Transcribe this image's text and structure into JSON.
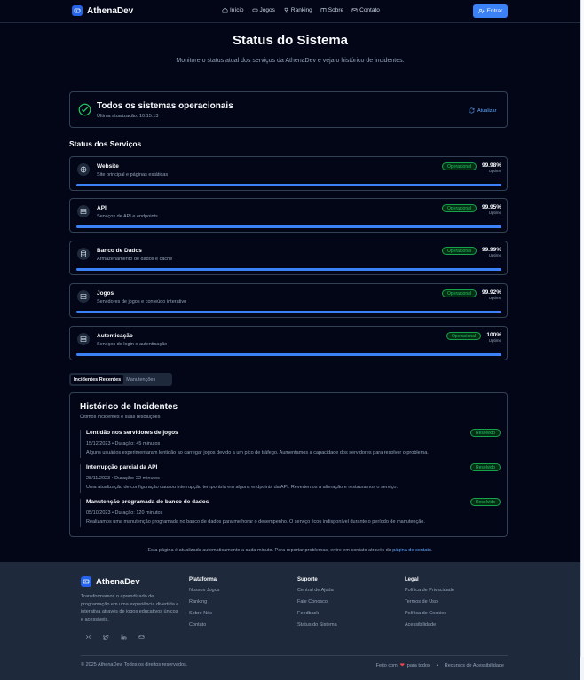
{
  "nav": {
    "brand": "AthenaDev",
    "links": [
      {
        "label": "Início",
        "icon": "home-icon"
      },
      {
        "label": "Jogos",
        "icon": "gamepad-icon"
      },
      {
        "label": "Ranking",
        "icon": "trophy-icon"
      },
      {
        "label": "Sobre",
        "icon": "book-icon"
      },
      {
        "label": "Contato",
        "icon": "mail-icon"
      }
    ],
    "login_label": "Entrar"
  },
  "hero": {
    "title": "Status do Sistema",
    "subtitle": "Monitore o status atual dos serviços da AthenaDev e veja o histórico de incidentes."
  },
  "overall": {
    "title": "Todos os sistemas operacionais",
    "updated": "Última atualização: 10:15:13",
    "refresh_label": "Atualizar"
  },
  "services_title": "Status dos Serviços",
  "services": [
    {
      "name": "Website",
      "desc": "Site principal e páginas estáticas",
      "status": "Operacional",
      "uptime": "99.98%",
      "uptime_fraction": 0.9998,
      "icon": "globe-icon"
    },
    {
      "name": "API",
      "desc": "Serviços de API e endpoints",
      "status": "Operacional",
      "uptime": "99.95%",
      "uptime_fraction": 0.9995,
      "icon": "server-icon"
    },
    {
      "name": "Banco de Dados",
      "desc": "Armazenamento de dados e cache",
      "status": "Operacional",
      "uptime": "99.99%",
      "uptime_fraction": 0.9999,
      "icon": "database-icon"
    },
    {
      "name": "Jogos",
      "desc": "Servidores de jogos e conteúdo interativo",
      "status": "Operacional",
      "uptime": "99.92%",
      "uptime_fraction": 0.9992,
      "icon": "server-icon"
    },
    {
      "name": "Autenticação",
      "desc": "Serviços de login e autenticação",
      "status": "Operacional",
      "uptime": "100%",
      "uptime_fraction": 1.0,
      "icon": "server-icon"
    }
  ],
  "uptime_label": "Uptime",
  "tabs": [
    "Incidentes Recentes",
    "Manutenções"
  ],
  "incidents": {
    "title": "Histórico de Incidentes",
    "subtitle": "Últimos incidentes e suas resoluções",
    "items": [
      {
        "name": "Lentidão nos servidores de jogos",
        "meta": "15/12/2023 • Duração: 45 minutos",
        "desc": "Alguns usuários experimentaram lentidão ao carregar jogos devido a um pico de tráfego. Aumentamos a capacidade dos servidores para resolver o problema.",
        "status": "Resolvido"
      },
      {
        "name": "Interrupção parcial da API",
        "meta": "28/11/2023 • Duração: 22 minutos",
        "desc": "Uma atualização de configuração causou interrupção temporária em alguns endpoints da API. Revertemos a alteração e restauramos o serviço.",
        "status": "Resolvido"
      },
      {
        "name": "Manutenção programada do banco de dados",
        "meta": "05/10/2023 • Duração: 120 minutos",
        "desc": "Realizamos uma manutenção programada no banco de dados para melhorar o desempenho. O serviço ficou indisponível durante o período de manutenção.",
        "status": "Resolvido"
      }
    ]
  },
  "note": {
    "text": "Esta página é atualizada automaticamente a cada minuto. Para reportar problemas, entre em contato através da",
    "link": "página de contato",
    "end": "."
  },
  "footer": {
    "brand": "AthenaDev",
    "about": "Transformamos o aprendizado de programação em uma experiência divertida e interativa através de jogos educativos únicos e acessíveis.",
    "social": [
      "twitter-icon",
      "twitter-bird-icon",
      "linkedin-icon",
      "mail-icon"
    ],
    "columns": [
      {
        "title": "Plataforma",
        "links": [
          "Nossos Jogos",
          "Ranking",
          "Sobre Nós",
          "Contato"
        ]
      },
      {
        "title": "Suporte",
        "links": [
          "Central de Ajuda",
          "Fale Conosco",
          "Feedback",
          "Status do Sistema"
        ]
      },
      {
        "title": "Legal",
        "links": [
          "Política de Privacidade",
          "Termos de Uso",
          "Política de Cookies",
          "Acessibilidade"
        ]
      }
    ],
    "copyright": "© 2025 AthenaDev. Todos os direitos reservados.",
    "made_prefix": "Feito com",
    "made_suffix": "para todos",
    "bullet": "•",
    "accessibility": "Recursos de Acessibilidade"
  },
  "colors": {
    "accent": "#3b82f6",
    "success": "#22c55e",
    "background": "#020617",
    "footer": "#1e293b"
  }
}
